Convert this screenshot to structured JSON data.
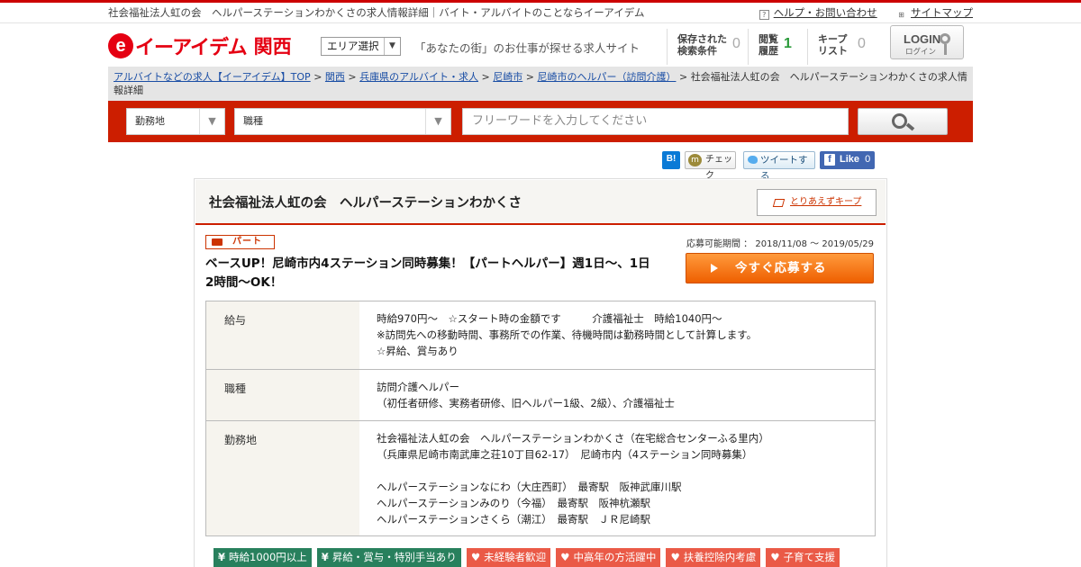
{
  "header": {
    "description": "社会福祉法人虹の会　ヘルパーステーションわかくさの求人情報詳細｜バイト・アルバイトのことならイーアイデム",
    "help_link": "ヘルプ・お問い合わせ",
    "sitemap_link": "サイトマップ"
  },
  "brand": {
    "logo_mark": "e",
    "logo_text": "イーアイデム",
    "region": "関西",
    "area_select_label": "エリア選択",
    "tagline": "「あなたの街」のお仕事が探せる求人サイト"
  },
  "stats": [
    {
      "label_line1": "保存された",
      "label_line2": "検索条件",
      "value": "0",
      "color": "#aaaaaa"
    },
    {
      "label_line1": "閲覧",
      "label_line2": "履歴",
      "value": "1",
      "color": "#2a9a3a"
    },
    {
      "label_line1": "キープ",
      "label_line2": "リスト",
      "value": "0",
      "color": "#aaaaaa"
    }
  ],
  "login": {
    "label": "LOGIN",
    "sub": "ログイン"
  },
  "breadcrumbs": {
    "links": [
      "アルバイトなどの求人【イーアイデム】TOP",
      "関西",
      "兵庫県のアルバイト・求人",
      "尼崎市",
      "尼崎市のヘルパー（訪問介護）"
    ],
    "current": "社会福祉法人虹の会　ヘルパーステーションわかくさの求人情報詳細",
    "separator": " > "
  },
  "search": {
    "location_label": "勤務地",
    "jobtype_label": "職種",
    "freeword_placeholder": "フリーワードを入力してください"
  },
  "social": {
    "hatena": "B!",
    "check": "チェック",
    "tweet": "ツイートする",
    "like": "Like",
    "like_count": "0"
  },
  "job": {
    "company": "社会福祉法人虹の会　ヘルパーステーションわかくさ",
    "keep_label": "とりあえずキープ",
    "employment_type": "パート",
    "period": "応募可能期間 ： 2018/11/08 ～ 2019/05/29",
    "title": "ベースUP！尼崎市内4ステーション同時募集！【パートヘルパー】週1日〜、1日2時間〜OK！",
    "apply_label": "今すぐ応募する",
    "details": [
      {
        "label": "給与",
        "value": "時給970円〜　☆スタート時の金額です　　　介護福祉士　時給1040円〜\n※訪問先への移動時間、事務所での作業、待機時間は勤務時間として計算します。\n☆昇給、賞与あり"
      },
      {
        "label": "職種",
        "value": "訪問介護ヘルパー\n（初任者研修、実務者研修、旧ヘルパー1級、2級）、介護福祉士"
      },
      {
        "label": "勤務地",
        "value": "社会福祉法人虹の会　ヘルパーステーションわかくさ（在宅総合センターふる里内）\n（兵庫県尼崎市南武庫之荘10丁目62-17）　尼崎市内（4ステーション同時募集）\n\nヘルパーステーションなにわ（大庄西町）　最寄駅　阪神武庫川駅\nヘルパーステーションみのり（今福）　最寄駅　阪神杭瀬駅\nヘルパーステーションさくら（潮江）　最寄駅　ＪＲ尼崎駅"
      }
    ],
    "tags": [
      {
        "icon": "¥",
        "text": "時給1000円以上",
        "kind": "g"
      },
      {
        "icon": "¥",
        "text": "昇給・賞与・特別手当あり",
        "kind": "g"
      },
      {
        "icon": "♥",
        "text": "未経験者歓迎",
        "kind": "r"
      },
      {
        "icon": "♥",
        "text": "中高年の方活躍中",
        "kind": "r"
      },
      {
        "icon": "♥",
        "text": "扶養控除内考慮",
        "kind": "r"
      },
      {
        "icon": "♥",
        "text": "子育て支援",
        "kind": "r"
      }
    ]
  },
  "colors": {
    "brand_red": "#e50012",
    "search_bar": "#cc1e00",
    "apply_orange": "#ee5f00",
    "tag_green": "#28805d",
    "tag_red": "#ea5a47",
    "link_blue": "#1a4ea5"
  }
}
